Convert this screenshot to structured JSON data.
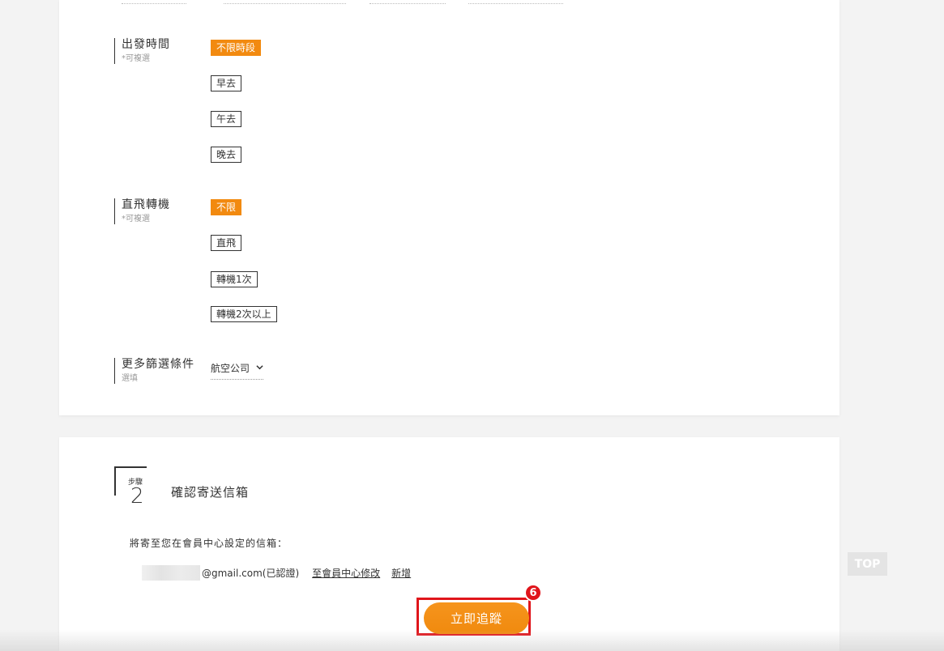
{
  "filters": {
    "departure_time": {
      "title": "出發時間",
      "hint": "*可複選",
      "options": [
        "不限時段",
        "早去",
        "午去",
        "晚去"
      ],
      "selected": "不限時段"
    },
    "direct_transfer": {
      "title": "直飛轉機",
      "hint": "*可複選",
      "options": [
        "不限",
        "直飛",
        "轉機1次",
        "轉機2次以上"
      ],
      "selected": "不限"
    },
    "more": {
      "title": "更多篩選條件",
      "hint": "選填",
      "airline_label": "航空公司",
      "chevron_icon": "chevron-down-icon"
    }
  },
  "step2": {
    "step_label": "步驟",
    "step_number": "2",
    "title": "確認寄送信箱",
    "notice": "將寄至您在會員中心設定的信箱：",
    "email_suffix": "@gmail.com(已認證)",
    "edit_link": "至會員中心修改",
    "add_link": "新增",
    "submit_label": "立即追蹤",
    "badge_number": "6"
  },
  "top_button": "TOP",
  "colors": {
    "accent": "#f28a10",
    "highlight": "#e0151b"
  }
}
